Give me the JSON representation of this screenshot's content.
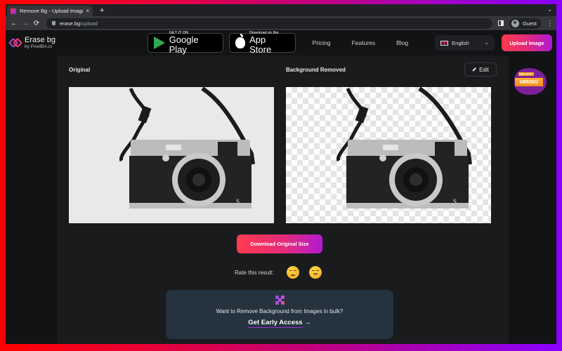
{
  "browser": {
    "tab_title": "Remove Bg - Upload Images to",
    "tab_close": "×",
    "new_tab": "+",
    "tab_dropdown": "⌄",
    "nav": {
      "back": "←",
      "forward": "→",
      "reload": "⟳"
    },
    "url_host": "erase.bg",
    "url_path": "/upload",
    "profile_label": "Guest",
    "menu": "⋮"
  },
  "header": {
    "logo_name": "Erase bg",
    "logo_by": "by PixelBin.io",
    "google_play": {
      "small": "GET IT ON",
      "big": "Google Play"
    },
    "app_store": {
      "small": "Download on the",
      "big": "App Store"
    },
    "nav_links": [
      "Pricing",
      "Features",
      "Blog"
    ],
    "language": {
      "selected": "English",
      "chevron": "⌄"
    },
    "upload_label": "Upload Image"
  },
  "result": {
    "original_label": "Original",
    "removed_label": "Background Removed",
    "edit_label": "Edit",
    "download_label": "Download Original Size",
    "rate_label": "Rate this result:",
    "rating_options": [
      "sad-face",
      "happy-face"
    ]
  },
  "bulk": {
    "text": "Want to Remove Background from Images in bulk?",
    "cta": "Get Early Access",
    "arrow": "→"
  },
  "hiring": {
    "tag": "WE ARE",
    "word": "HIRING"
  },
  "colors": {
    "accent_start": "#ff3b4e",
    "accent_end": "#b018d6",
    "page_bg": "#121315",
    "panel_bg": "#1a1b1d",
    "bulk_bg": "#25333f"
  }
}
